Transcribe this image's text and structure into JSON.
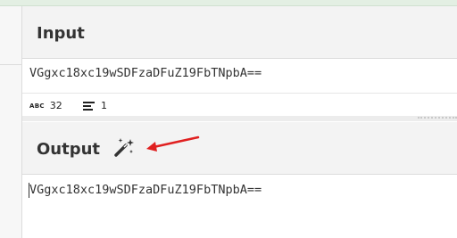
{
  "input": {
    "title": "Input",
    "value": "VGgxc18xc19wSDFzaDFuZ19FbTNpbA==",
    "stats": {
      "chars_label": "abc",
      "chars": "32",
      "lines": "1"
    }
  },
  "output": {
    "title": "Output",
    "value": "VGgxc18xc19wSDFzaDFuZ19FbTNpbA==",
    "magic_icon": "magic-wand-icon"
  },
  "colors": {
    "arrow": "#e02020",
    "header_bg": "#f3f3f3",
    "top_bar": "#e3efe3"
  }
}
